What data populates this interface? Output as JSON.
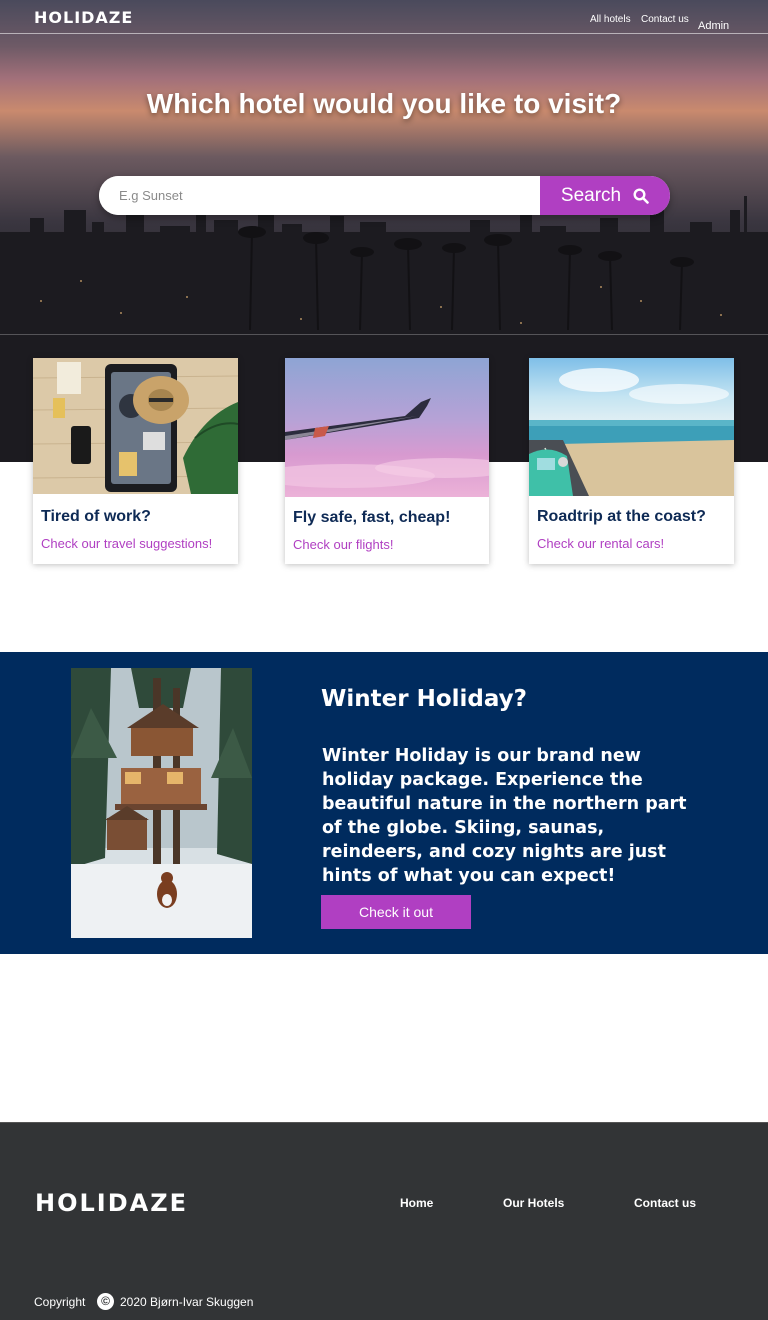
{
  "nav": {
    "logo": "HOLIDAZE",
    "links": [
      "All hotels",
      "Contact us"
    ],
    "admin": "Admin"
  },
  "hero": {
    "title": "Which hotel would you like to visit?",
    "search_placeholder": "E.g Sunset",
    "search_button": "Search"
  },
  "cards": [
    {
      "title": "Tired of work?",
      "link": "Check our travel suggestions!"
    },
    {
      "title": "Fly safe, fast, cheap!",
      "link": "Check our flights!"
    },
    {
      "title": "Roadtrip at the coast?",
      "link": "Check our rental cars!"
    }
  ],
  "winter": {
    "title": "Winter Holiday?",
    "text": "Winter Holiday is our brand new holiday package. Experience the beautiful nature in the northern part of the globe. Skiing, saunas, reindeers, and cozy nights are just hints of what you can expect!",
    "button": "Check it out"
  },
  "footer": {
    "logo": "HOLIDAZE",
    "links": [
      "Home",
      "Our Hotels",
      "Contact us"
    ],
    "copyright_label": "Copyright",
    "copyright_icon": "©",
    "copyright_text": "2020 Bjørn-Ivar Skuggen"
  },
  "colors": {
    "accent": "#b03fc2",
    "navy": "#002b5e",
    "title_navy": "#0e2a55",
    "footer_bg": "#323436"
  }
}
